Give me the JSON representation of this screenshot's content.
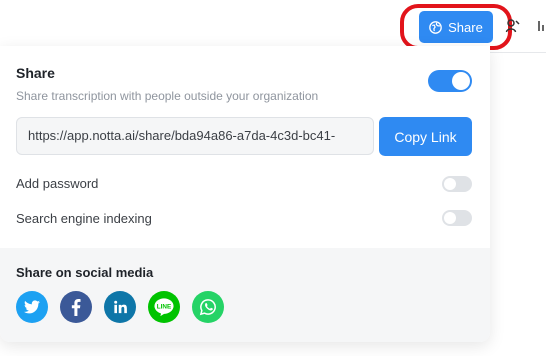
{
  "header": {
    "share_button_label": "Share"
  },
  "share_panel": {
    "title": "Share",
    "description": "Share transcription with people outside your organization",
    "share_enabled": true,
    "link": {
      "value": "https://app.notta.ai/share/bda94a86-a7da-4c3d-bc41-",
      "copy_label": "Copy Link"
    },
    "options": [
      {
        "label": "Add password",
        "enabled": false
      },
      {
        "label": "Search engine indexing",
        "enabled": false
      }
    ],
    "social": {
      "title": "Share on social media",
      "icons": [
        {
          "name": "twitter-icon",
          "color": "#1da1f2"
        },
        {
          "name": "facebook-icon",
          "color": "#3b5998"
        },
        {
          "name": "linkedin-icon",
          "color": "#0e76a8"
        },
        {
          "name": "line-icon",
          "color": "#00c300"
        },
        {
          "name": "whatsapp-icon",
          "color": "#25d366"
        }
      ]
    }
  },
  "colors": {
    "accent": "#2f8af2",
    "highlight": "#e2141b"
  }
}
